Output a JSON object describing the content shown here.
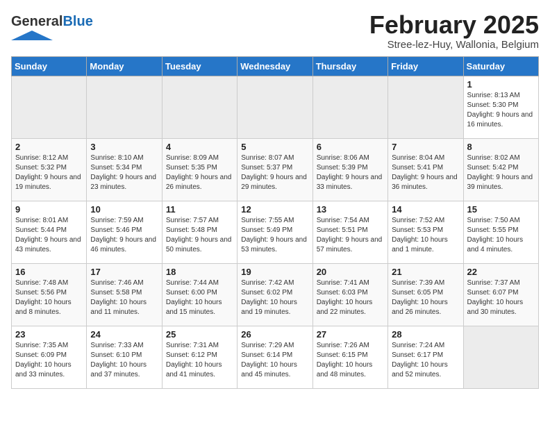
{
  "header": {
    "logo_general": "General",
    "logo_blue": "Blue",
    "month": "February 2025",
    "location": "Stree-lez-Huy, Wallonia, Belgium"
  },
  "days_of_week": [
    "Sunday",
    "Monday",
    "Tuesday",
    "Wednesday",
    "Thursday",
    "Friday",
    "Saturday"
  ],
  "weeks": [
    [
      {
        "day": "",
        "info": ""
      },
      {
        "day": "",
        "info": ""
      },
      {
        "day": "",
        "info": ""
      },
      {
        "day": "",
        "info": ""
      },
      {
        "day": "",
        "info": ""
      },
      {
        "day": "",
        "info": ""
      },
      {
        "day": "1",
        "info": "Sunrise: 8:13 AM\nSunset: 5:30 PM\nDaylight: 9 hours and 16 minutes."
      }
    ],
    [
      {
        "day": "2",
        "info": "Sunrise: 8:12 AM\nSunset: 5:32 PM\nDaylight: 9 hours and 19 minutes."
      },
      {
        "day": "3",
        "info": "Sunrise: 8:10 AM\nSunset: 5:34 PM\nDaylight: 9 hours and 23 minutes."
      },
      {
        "day": "4",
        "info": "Sunrise: 8:09 AM\nSunset: 5:35 PM\nDaylight: 9 hours and 26 minutes."
      },
      {
        "day": "5",
        "info": "Sunrise: 8:07 AM\nSunset: 5:37 PM\nDaylight: 9 hours and 29 minutes."
      },
      {
        "day": "6",
        "info": "Sunrise: 8:06 AM\nSunset: 5:39 PM\nDaylight: 9 hours and 33 minutes."
      },
      {
        "day": "7",
        "info": "Sunrise: 8:04 AM\nSunset: 5:41 PM\nDaylight: 9 hours and 36 minutes."
      },
      {
        "day": "8",
        "info": "Sunrise: 8:02 AM\nSunset: 5:42 PM\nDaylight: 9 hours and 39 minutes."
      }
    ],
    [
      {
        "day": "9",
        "info": "Sunrise: 8:01 AM\nSunset: 5:44 PM\nDaylight: 9 hours and 43 minutes."
      },
      {
        "day": "10",
        "info": "Sunrise: 7:59 AM\nSunset: 5:46 PM\nDaylight: 9 hours and 46 minutes."
      },
      {
        "day": "11",
        "info": "Sunrise: 7:57 AM\nSunset: 5:48 PM\nDaylight: 9 hours and 50 minutes."
      },
      {
        "day": "12",
        "info": "Sunrise: 7:55 AM\nSunset: 5:49 PM\nDaylight: 9 hours and 53 minutes."
      },
      {
        "day": "13",
        "info": "Sunrise: 7:54 AM\nSunset: 5:51 PM\nDaylight: 9 hours and 57 minutes."
      },
      {
        "day": "14",
        "info": "Sunrise: 7:52 AM\nSunset: 5:53 PM\nDaylight: 10 hours and 1 minute."
      },
      {
        "day": "15",
        "info": "Sunrise: 7:50 AM\nSunset: 5:55 PM\nDaylight: 10 hours and 4 minutes."
      }
    ],
    [
      {
        "day": "16",
        "info": "Sunrise: 7:48 AM\nSunset: 5:56 PM\nDaylight: 10 hours and 8 minutes."
      },
      {
        "day": "17",
        "info": "Sunrise: 7:46 AM\nSunset: 5:58 PM\nDaylight: 10 hours and 11 minutes."
      },
      {
        "day": "18",
        "info": "Sunrise: 7:44 AM\nSunset: 6:00 PM\nDaylight: 10 hours and 15 minutes."
      },
      {
        "day": "19",
        "info": "Sunrise: 7:42 AM\nSunset: 6:02 PM\nDaylight: 10 hours and 19 minutes."
      },
      {
        "day": "20",
        "info": "Sunrise: 7:41 AM\nSunset: 6:03 PM\nDaylight: 10 hours and 22 minutes."
      },
      {
        "day": "21",
        "info": "Sunrise: 7:39 AM\nSunset: 6:05 PM\nDaylight: 10 hours and 26 minutes."
      },
      {
        "day": "22",
        "info": "Sunrise: 7:37 AM\nSunset: 6:07 PM\nDaylight: 10 hours and 30 minutes."
      }
    ],
    [
      {
        "day": "23",
        "info": "Sunrise: 7:35 AM\nSunset: 6:09 PM\nDaylight: 10 hours and 33 minutes."
      },
      {
        "day": "24",
        "info": "Sunrise: 7:33 AM\nSunset: 6:10 PM\nDaylight: 10 hours and 37 minutes."
      },
      {
        "day": "25",
        "info": "Sunrise: 7:31 AM\nSunset: 6:12 PM\nDaylight: 10 hours and 41 minutes."
      },
      {
        "day": "26",
        "info": "Sunrise: 7:29 AM\nSunset: 6:14 PM\nDaylight: 10 hours and 45 minutes."
      },
      {
        "day": "27",
        "info": "Sunrise: 7:26 AM\nSunset: 6:15 PM\nDaylight: 10 hours and 48 minutes."
      },
      {
        "day": "28",
        "info": "Sunrise: 7:24 AM\nSunset: 6:17 PM\nDaylight: 10 hours and 52 minutes."
      },
      {
        "day": "",
        "info": ""
      }
    ]
  ]
}
